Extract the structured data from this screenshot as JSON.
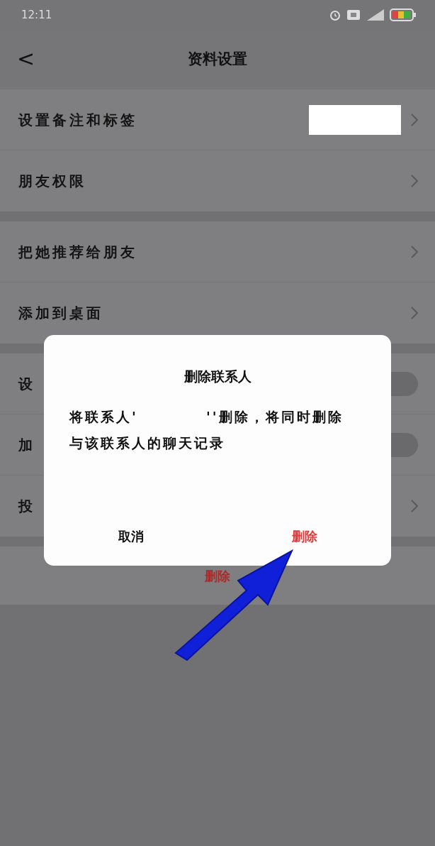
{
  "status_bar": {
    "time": "12:11"
  },
  "nav": {
    "back": "<",
    "title": "资料设置"
  },
  "groups": [
    {
      "rows": [
        {
          "kind": "chevron",
          "label": "设置备注和标签",
          "redacted": true
        },
        {
          "kind": "chevron",
          "label": "朋友权限"
        }
      ]
    },
    {
      "rows": [
        {
          "kind": "chevron",
          "label": "把她推荐给朋友"
        },
        {
          "kind": "chevron",
          "label": "添加到桌面"
        }
      ]
    },
    {
      "rows": [
        {
          "kind": "toggle",
          "label": "设",
          "on": false
        },
        {
          "kind": "toggle",
          "label": "加",
          "on": false
        },
        {
          "kind": "chevron",
          "label": "投"
        }
      ]
    }
  ],
  "delete_button": "删除",
  "dialog": {
    "title": "删除联系人",
    "message": "将联系人'          ''删除，将同时删除与该联系人的聊天记录",
    "buttons": [
      {
        "label": "取消",
        "kind": "cancel"
      },
      {
        "label": "删除",
        "kind": "danger"
      }
    ]
  }
}
